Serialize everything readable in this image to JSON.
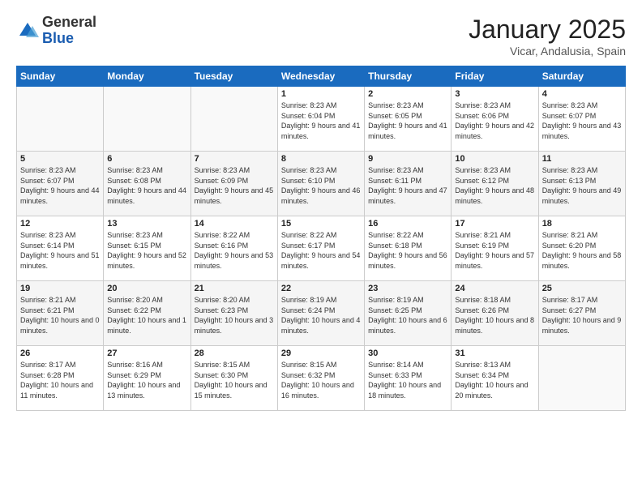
{
  "logo": {
    "general": "General",
    "blue": "Blue"
  },
  "title": "January 2025",
  "subtitle": "Vicar, Andalusia, Spain",
  "days_of_week": [
    "Sunday",
    "Monday",
    "Tuesday",
    "Wednesday",
    "Thursday",
    "Friday",
    "Saturday"
  ],
  "weeks": [
    [
      {
        "num": "",
        "info": ""
      },
      {
        "num": "",
        "info": ""
      },
      {
        "num": "",
        "info": ""
      },
      {
        "num": "1",
        "info": "Sunrise: 8:23 AM\nSunset: 6:04 PM\nDaylight: 9 hours and 41 minutes."
      },
      {
        "num": "2",
        "info": "Sunrise: 8:23 AM\nSunset: 6:05 PM\nDaylight: 9 hours and 41 minutes."
      },
      {
        "num": "3",
        "info": "Sunrise: 8:23 AM\nSunset: 6:06 PM\nDaylight: 9 hours and 42 minutes."
      },
      {
        "num": "4",
        "info": "Sunrise: 8:23 AM\nSunset: 6:07 PM\nDaylight: 9 hours and 43 minutes."
      }
    ],
    [
      {
        "num": "5",
        "info": "Sunrise: 8:23 AM\nSunset: 6:07 PM\nDaylight: 9 hours and 44 minutes."
      },
      {
        "num": "6",
        "info": "Sunrise: 8:23 AM\nSunset: 6:08 PM\nDaylight: 9 hours and 44 minutes."
      },
      {
        "num": "7",
        "info": "Sunrise: 8:23 AM\nSunset: 6:09 PM\nDaylight: 9 hours and 45 minutes."
      },
      {
        "num": "8",
        "info": "Sunrise: 8:23 AM\nSunset: 6:10 PM\nDaylight: 9 hours and 46 minutes."
      },
      {
        "num": "9",
        "info": "Sunrise: 8:23 AM\nSunset: 6:11 PM\nDaylight: 9 hours and 47 minutes."
      },
      {
        "num": "10",
        "info": "Sunrise: 8:23 AM\nSunset: 6:12 PM\nDaylight: 9 hours and 48 minutes."
      },
      {
        "num": "11",
        "info": "Sunrise: 8:23 AM\nSunset: 6:13 PM\nDaylight: 9 hours and 49 minutes."
      }
    ],
    [
      {
        "num": "12",
        "info": "Sunrise: 8:23 AM\nSunset: 6:14 PM\nDaylight: 9 hours and 51 minutes."
      },
      {
        "num": "13",
        "info": "Sunrise: 8:23 AM\nSunset: 6:15 PM\nDaylight: 9 hours and 52 minutes."
      },
      {
        "num": "14",
        "info": "Sunrise: 8:22 AM\nSunset: 6:16 PM\nDaylight: 9 hours and 53 minutes."
      },
      {
        "num": "15",
        "info": "Sunrise: 8:22 AM\nSunset: 6:17 PM\nDaylight: 9 hours and 54 minutes."
      },
      {
        "num": "16",
        "info": "Sunrise: 8:22 AM\nSunset: 6:18 PM\nDaylight: 9 hours and 56 minutes."
      },
      {
        "num": "17",
        "info": "Sunrise: 8:21 AM\nSunset: 6:19 PM\nDaylight: 9 hours and 57 minutes."
      },
      {
        "num": "18",
        "info": "Sunrise: 8:21 AM\nSunset: 6:20 PM\nDaylight: 9 hours and 58 minutes."
      }
    ],
    [
      {
        "num": "19",
        "info": "Sunrise: 8:21 AM\nSunset: 6:21 PM\nDaylight: 10 hours and 0 minutes."
      },
      {
        "num": "20",
        "info": "Sunrise: 8:20 AM\nSunset: 6:22 PM\nDaylight: 10 hours and 1 minute."
      },
      {
        "num": "21",
        "info": "Sunrise: 8:20 AM\nSunset: 6:23 PM\nDaylight: 10 hours and 3 minutes."
      },
      {
        "num": "22",
        "info": "Sunrise: 8:19 AM\nSunset: 6:24 PM\nDaylight: 10 hours and 4 minutes."
      },
      {
        "num": "23",
        "info": "Sunrise: 8:19 AM\nSunset: 6:25 PM\nDaylight: 10 hours and 6 minutes."
      },
      {
        "num": "24",
        "info": "Sunrise: 8:18 AM\nSunset: 6:26 PM\nDaylight: 10 hours and 8 minutes."
      },
      {
        "num": "25",
        "info": "Sunrise: 8:17 AM\nSunset: 6:27 PM\nDaylight: 10 hours and 9 minutes."
      }
    ],
    [
      {
        "num": "26",
        "info": "Sunrise: 8:17 AM\nSunset: 6:28 PM\nDaylight: 10 hours and 11 minutes."
      },
      {
        "num": "27",
        "info": "Sunrise: 8:16 AM\nSunset: 6:29 PM\nDaylight: 10 hours and 13 minutes."
      },
      {
        "num": "28",
        "info": "Sunrise: 8:15 AM\nSunset: 6:30 PM\nDaylight: 10 hours and 15 minutes."
      },
      {
        "num": "29",
        "info": "Sunrise: 8:15 AM\nSunset: 6:32 PM\nDaylight: 10 hours and 16 minutes."
      },
      {
        "num": "30",
        "info": "Sunrise: 8:14 AM\nSunset: 6:33 PM\nDaylight: 10 hours and 18 minutes."
      },
      {
        "num": "31",
        "info": "Sunrise: 8:13 AM\nSunset: 6:34 PM\nDaylight: 10 hours and 20 minutes."
      },
      {
        "num": "",
        "info": ""
      }
    ]
  ]
}
